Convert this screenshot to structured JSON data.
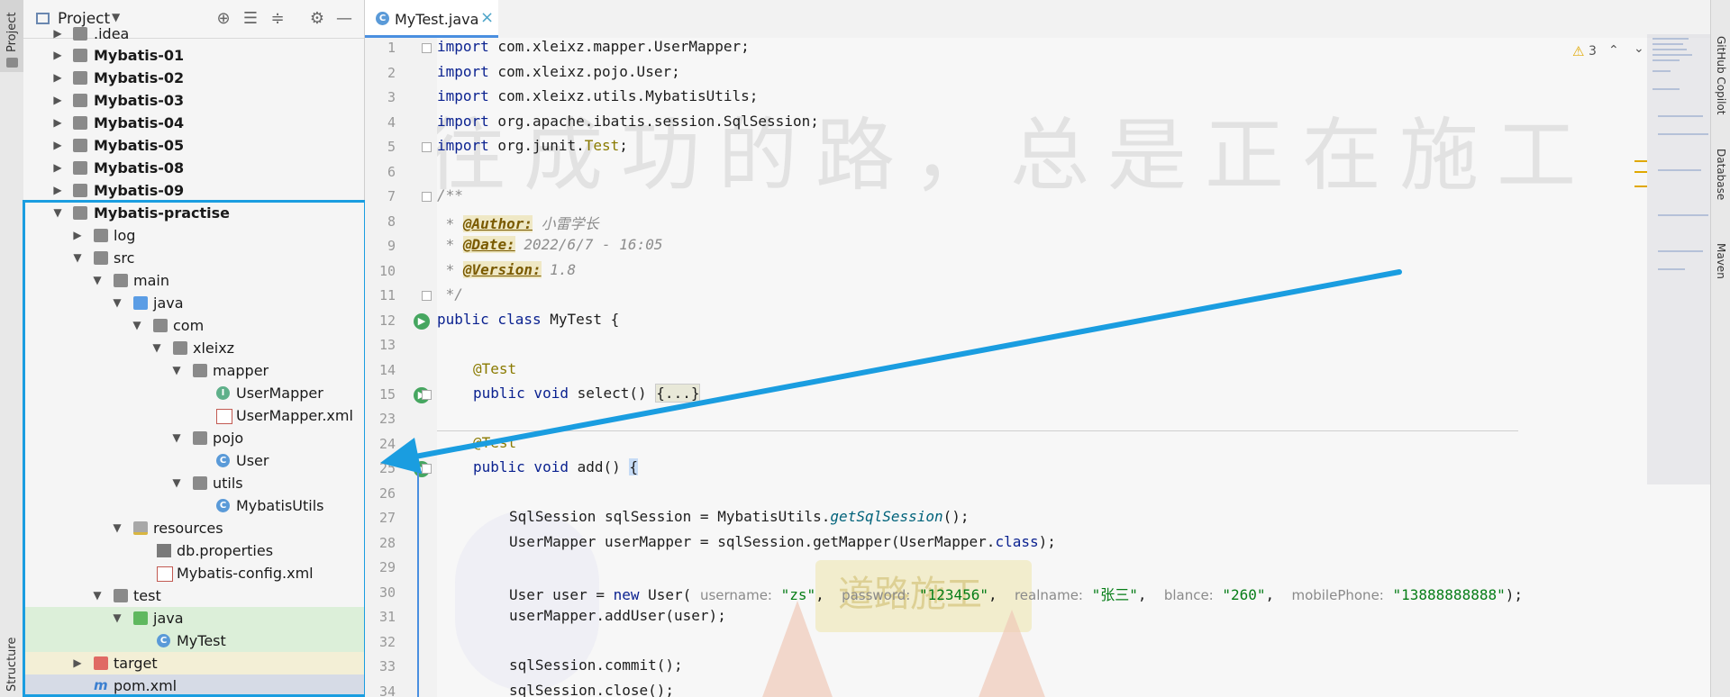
{
  "left_strip": {
    "project_tab": "Project",
    "structure_tab": "Structure"
  },
  "right_strip": {
    "copilot": "GitHub Copilot",
    "database": "Database",
    "maven": "Maven"
  },
  "project_panel": {
    "title": "Project",
    "tree": [
      {
        "label": ".idea",
        "bold": false
      },
      {
        "label": "Mybatis-01",
        "bold": true
      },
      {
        "label": "Mybatis-02",
        "bold": true
      },
      {
        "label": "Mybatis-03",
        "bold": true
      },
      {
        "label": "Mybatis-04",
        "bold": true
      },
      {
        "label": "Mybatis-05",
        "bold": true
      },
      {
        "label": "Mybatis-08",
        "bold": true
      },
      {
        "label": "Mybatis-09",
        "bold": true
      },
      {
        "label": "Mybatis-practise",
        "bold": true
      },
      {
        "label": "log"
      },
      {
        "label": "src"
      },
      {
        "label": "main"
      },
      {
        "label": "java"
      },
      {
        "label": "com"
      },
      {
        "label": "xleixz"
      },
      {
        "label": "mapper"
      },
      {
        "label": "UserMapper"
      },
      {
        "label": "UserMapper.xml"
      },
      {
        "label": "pojo"
      },
      {
        "label": "User"
      },
      {
        "label": "utils"
      },
      {
        "label": "MybatisUtils"
      },
      {
        "label": "resources"
      },
      {
        "label": "db.properties"
      },
      {
        "label": "Mybatis-config.xml"
      },
      {
        "label": "test"
      },
      {
        "label": "java"
      },
      {
        "label": "MyTest"
      },
      {
        "label": "target"
      },
      {
        "label": "pom.xml"
      }
    ]
  },
  "editor": {
    "tab_label": "MyTest.java",
    "tab_close": "×",
    "warnings_count": "3",
    "line_numbers": [
      "1",
      "2",
      "3",
      "4",
      "5",
      "6",
      "7",
      "8",
      "9",
      "10",
      "11",
      "12",
      "13",
      "14",
      "15",
      "23",
      "24",
      "25",
      "26",
      "27",
      "28",
      "29",
      "30",
      "31",
      "32",
      "33",
      "34"
    ],
    "code": {
      "l1_kw": "import",
      "l1": " com.xleixz.mapper.UserMapper;",
      "l2_kw": "import",
      "l2": " com.xleixz.pojo.User;",
      "l3_kw": "import",
      "l3": " com.xleixz.utils.MybatisUtils;",
      "l4_kw": "import",
      "l4": " org.apache.ibatis.session.SqlSession;",
      "l5_kw": "import",
      "l5a": " org.junit.",
      "l5b": "Test",
      "l5c": ";",
      "l7": "/**",
      "l8a": " * ",
      "l8tag": "@Author:",
      "l8b": " 小雷学长",
      "l9a": " * ",
      "l9tag": "@Date:",
      "l9b": " 2022/6/7 - 16:05",
      "l10a": " * ",
      "l10tag": "@Version:",
      "l10b": " 1.8",
      "l11": " */",
      "l12_kw": "public class",
      "l12": " MyTest {",
      "l14": "@Test",
      "l15_kw": "public void",
      "l15": " select() ",
      "l15fold": "{...}",
      "l23": "@Test",
      "l24_kw": "public void",
      "l24": " add() ",
      "l24b": "{",
      "l26a": "SqlSession sqlSession = MybatisUtils.",
      "l26fn": "getSqlSession",
      "l26b": "();",
      "l27a": "UserMapper userMapper = sqlSession.getMapper(UserMapper.",
      "l27kw": "class",
      "l27b": ");",
      "l29a": "User user = ",
      "l29kw": "new",
      "l29b": " User( ",
      "h1": "username:",
      "v1": "\"zs\"",
      "h2": "password:",
      "v2": "\"123456\"",
      "h3": "realname:",
      "v3": "\"张三\"",
      "h4": "blance:",
      "v4": "\"260\"",
      "h5": "mobilePhone:",
      "v5": "\"13888888888\"",
      "l29end": ");",
      "l30": "userMapper.addUser(user);",
      "l32": "sqlSession.commit();",
      "l33": "sqlSession.close();"
    }
  },
  "watermark": {
    "text": "通往成功的路，总是正在施工",
    "sign": "道路施工"
  },
  "colors": {
    "accent": "#1a9de0",
    "keyword": "#0b2290",
    "string": "#067d17",
    "annotation": "#8a7a00"
  }
}
